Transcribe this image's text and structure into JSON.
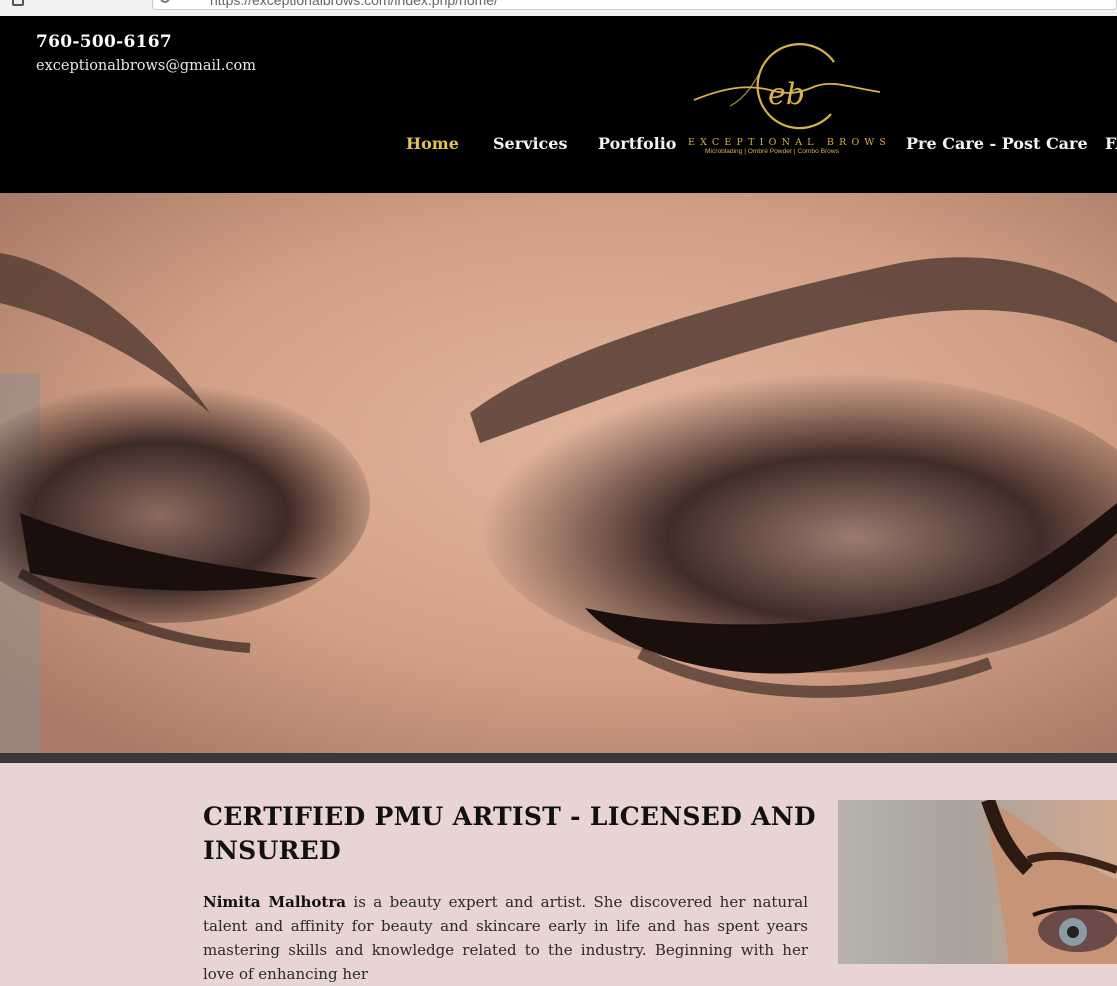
{
  "browser": {
    "url": "https://exceptionalbrows.com/index.php/home/"
  },
  "header": {
    "phone": "760-500-6167",
    "email": "exceptionalbrows@gmail.com",
    "logo": {
      "monogram": "eb",
      "name": "EXCEPTIONAL BROWS",
      "tagline": "Microblading | Ombré Powder | Combo Brows",
      "color": "#d7b14a"
    },
    "nav": {
      "home": "Home",
      "services": "Services",
      "portfolio": "Portfolio",
      "precare": "Pre Care - Post Care",
      "faq": "FAQ"
    },
    "active_color": "#e5c253"
  },
  "hero": {
    "icon": "eye-makeup-photo"
  },
  "intro": {
    "headline": "CERTIFIED PMU ARTIST - LICENSED AND INSURED",
    "artist_name": "Nimita Malhotra",
    "bio": " is a beauty expert and artist. She discovered her natural talent and affinity for beauty and skincare early in life and has spent years mastering skills and knowledge related to the industry. Beginning with her love of enhancing her"
  }
}
